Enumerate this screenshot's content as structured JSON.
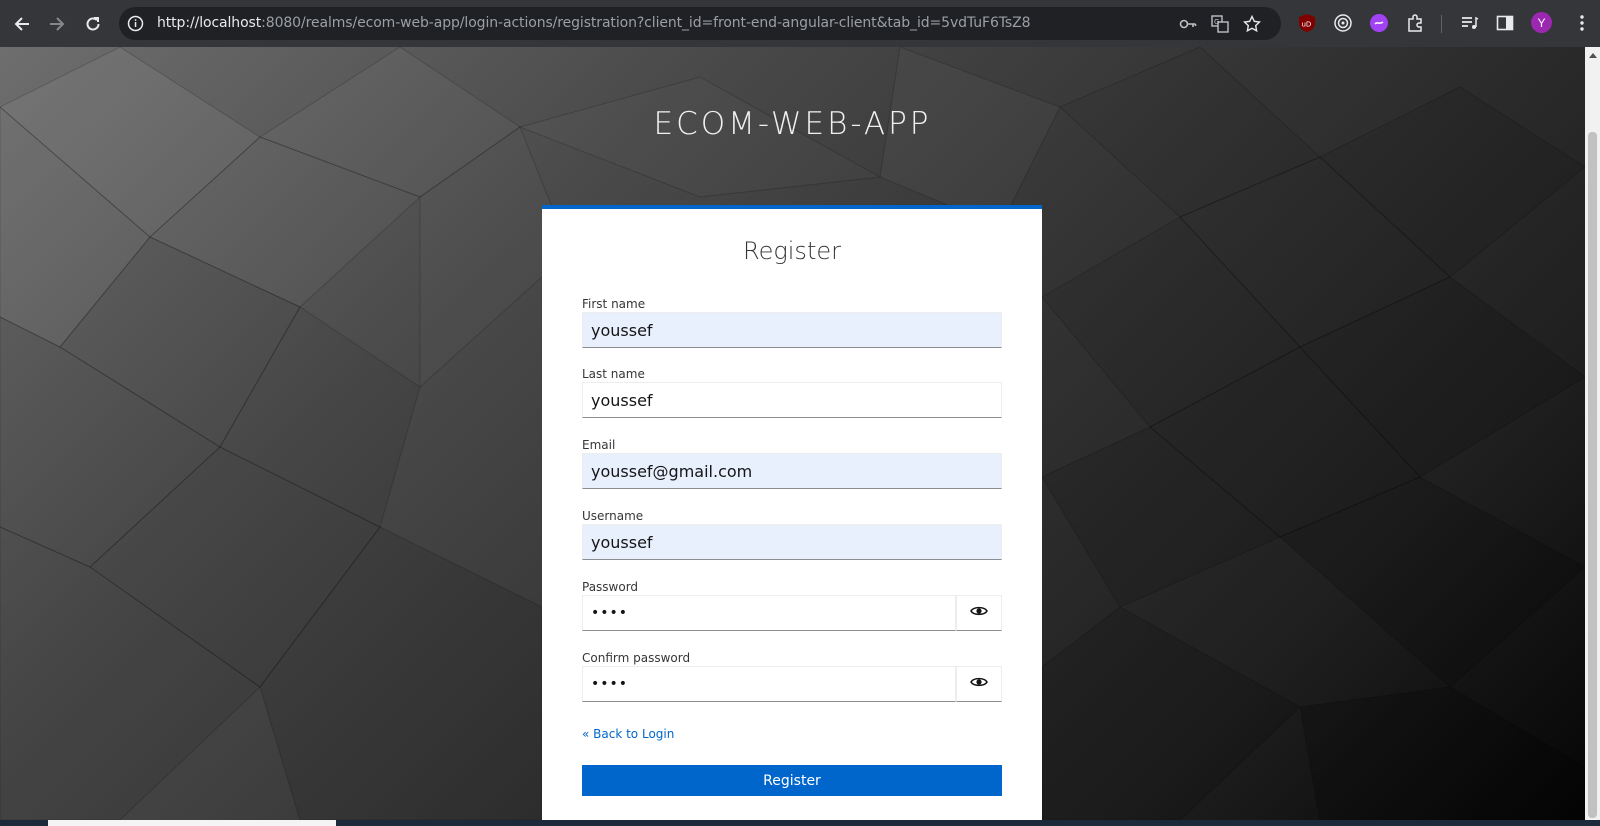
{
  "browser": {
    "url_host": "http://localhost",
    "url_rest": ":8080/realms/ecom-web-app/login-actions/registration?client_id=front-end-angular-client&tab_id=5vdTuF6TsZ8",
    "profile_initial": "Y",
    "extension_badge": "uD"
  },
  "page": {
    "realm_title": "ECOM-WEB-APP",
    "card_title": "Register",
    "fields": [
      {
        "label": "First name",
        "value": "youssef"
      },
      {
        "label": "Last name",
        "value": "youssef"
      },
      {
        "label": "Email",
        "value": "youssef@gmail.com"
      },
      {
        "label": "Username",
        "value": "youssef"
      },
      {
        "label": "Password",
        "value": "••••"
      },
      {
        "label": "Confirm password",
        "value": "••••"
      }
    ],
    "back_link": "« Back to Login",
    "register_button": "Register"
  },
  "colors": {
    "accent": "#0066cc",
    "autofill": "#e8f0fe"
  }
}
